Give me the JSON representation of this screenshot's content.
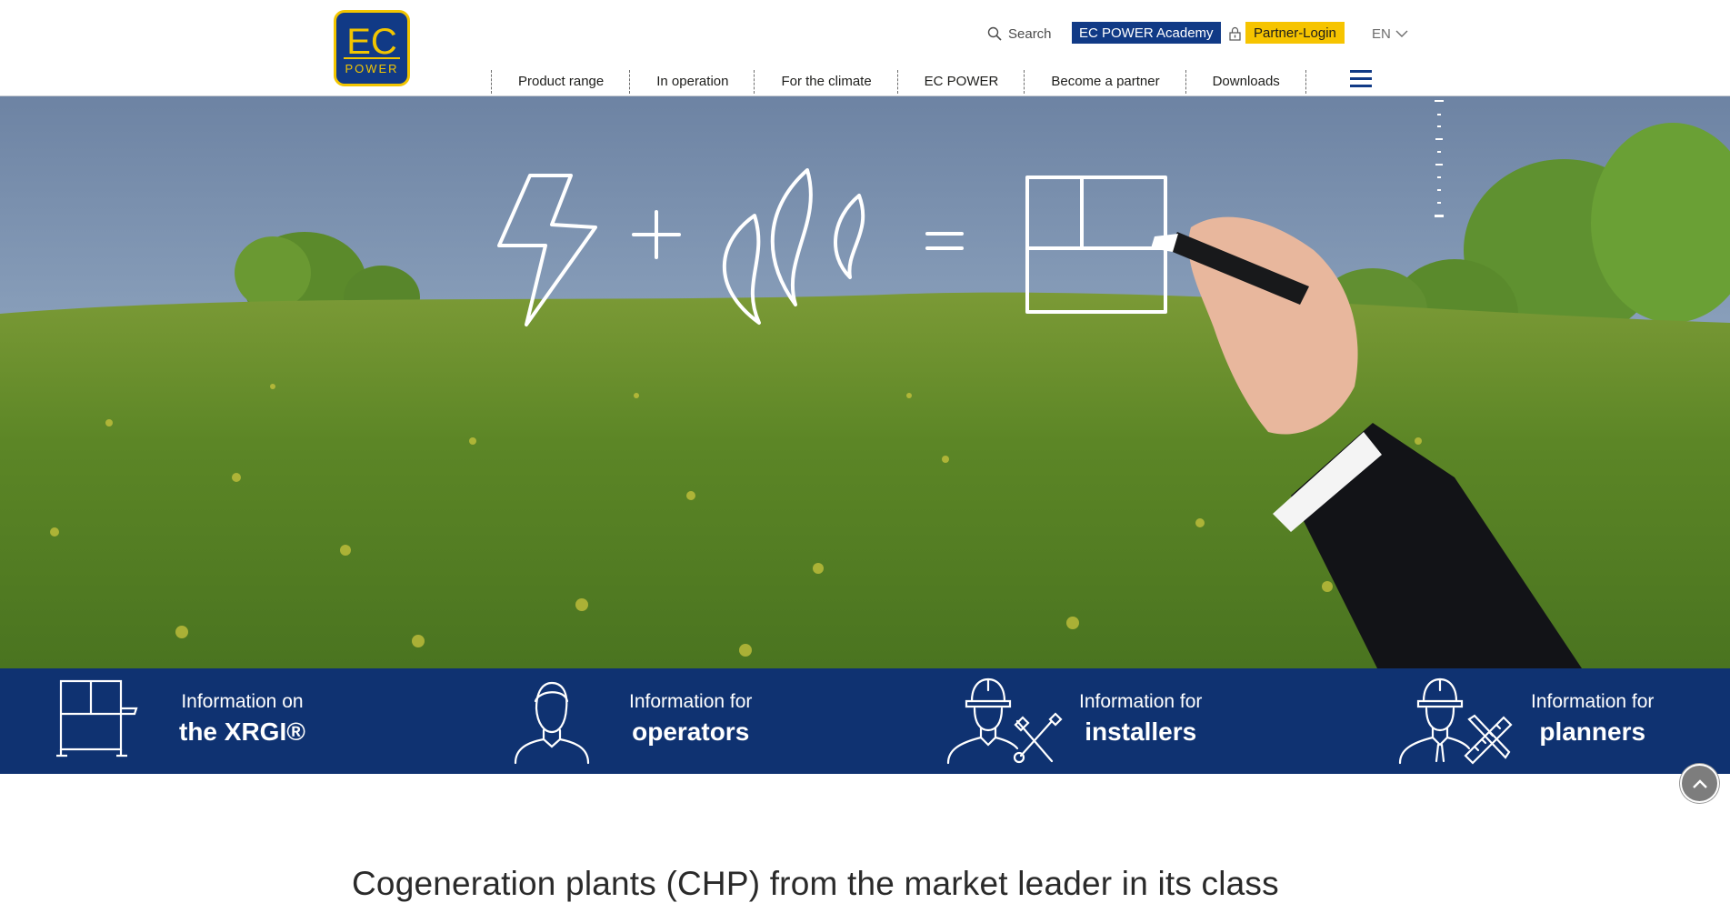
{
  "brand": {
    "logo_text_top": "EC",
    "logo_text_bottom": "POWER"
  },
  "header": {
    "search_label": "Search",
    "academy_label": "EC POWER Academy",
    "partner_login_label": "Partner-Login",
    "language": "EN"
  },
  "nav": {
    "items": [
      {
        "label": "Product range"
      },
      {
        "label": "In operation"
      },
      {
        "label": "For the climate"
      },
      {
        "label": "EC POWER"
      },
      {
        "label": "Become a partner"
      },
      {
        "label": "Downloads"
      }
    ]
  },
  "info_band": {
    "items": [
      {
        "line1": "Information on",
        "line2": "the XRGI®",
        "icon": "xrgi-unit-icon"
      },
      {
        "line1": "Information for",
        "line2": "operators",
        "icon": "operator-person-icon"
      },
      {
        "line1": "Information for",
        "line2": "installers",
        "icon": "installer-tools-icon"
      },
      {
        "line1": "Information for",
        "line2": "planners",
        "icon": "planner-ruler-icon"
      }
    ]
  },
  "main": {
    "heading": "Cogeneration plants (CHP) from the market leader in its class"
  },
  "colors": {
    "brand_blue": "#113a86",
    "brand_yellow": "#f6c400",
    "band_blue": "#0f3271"
  }
}
